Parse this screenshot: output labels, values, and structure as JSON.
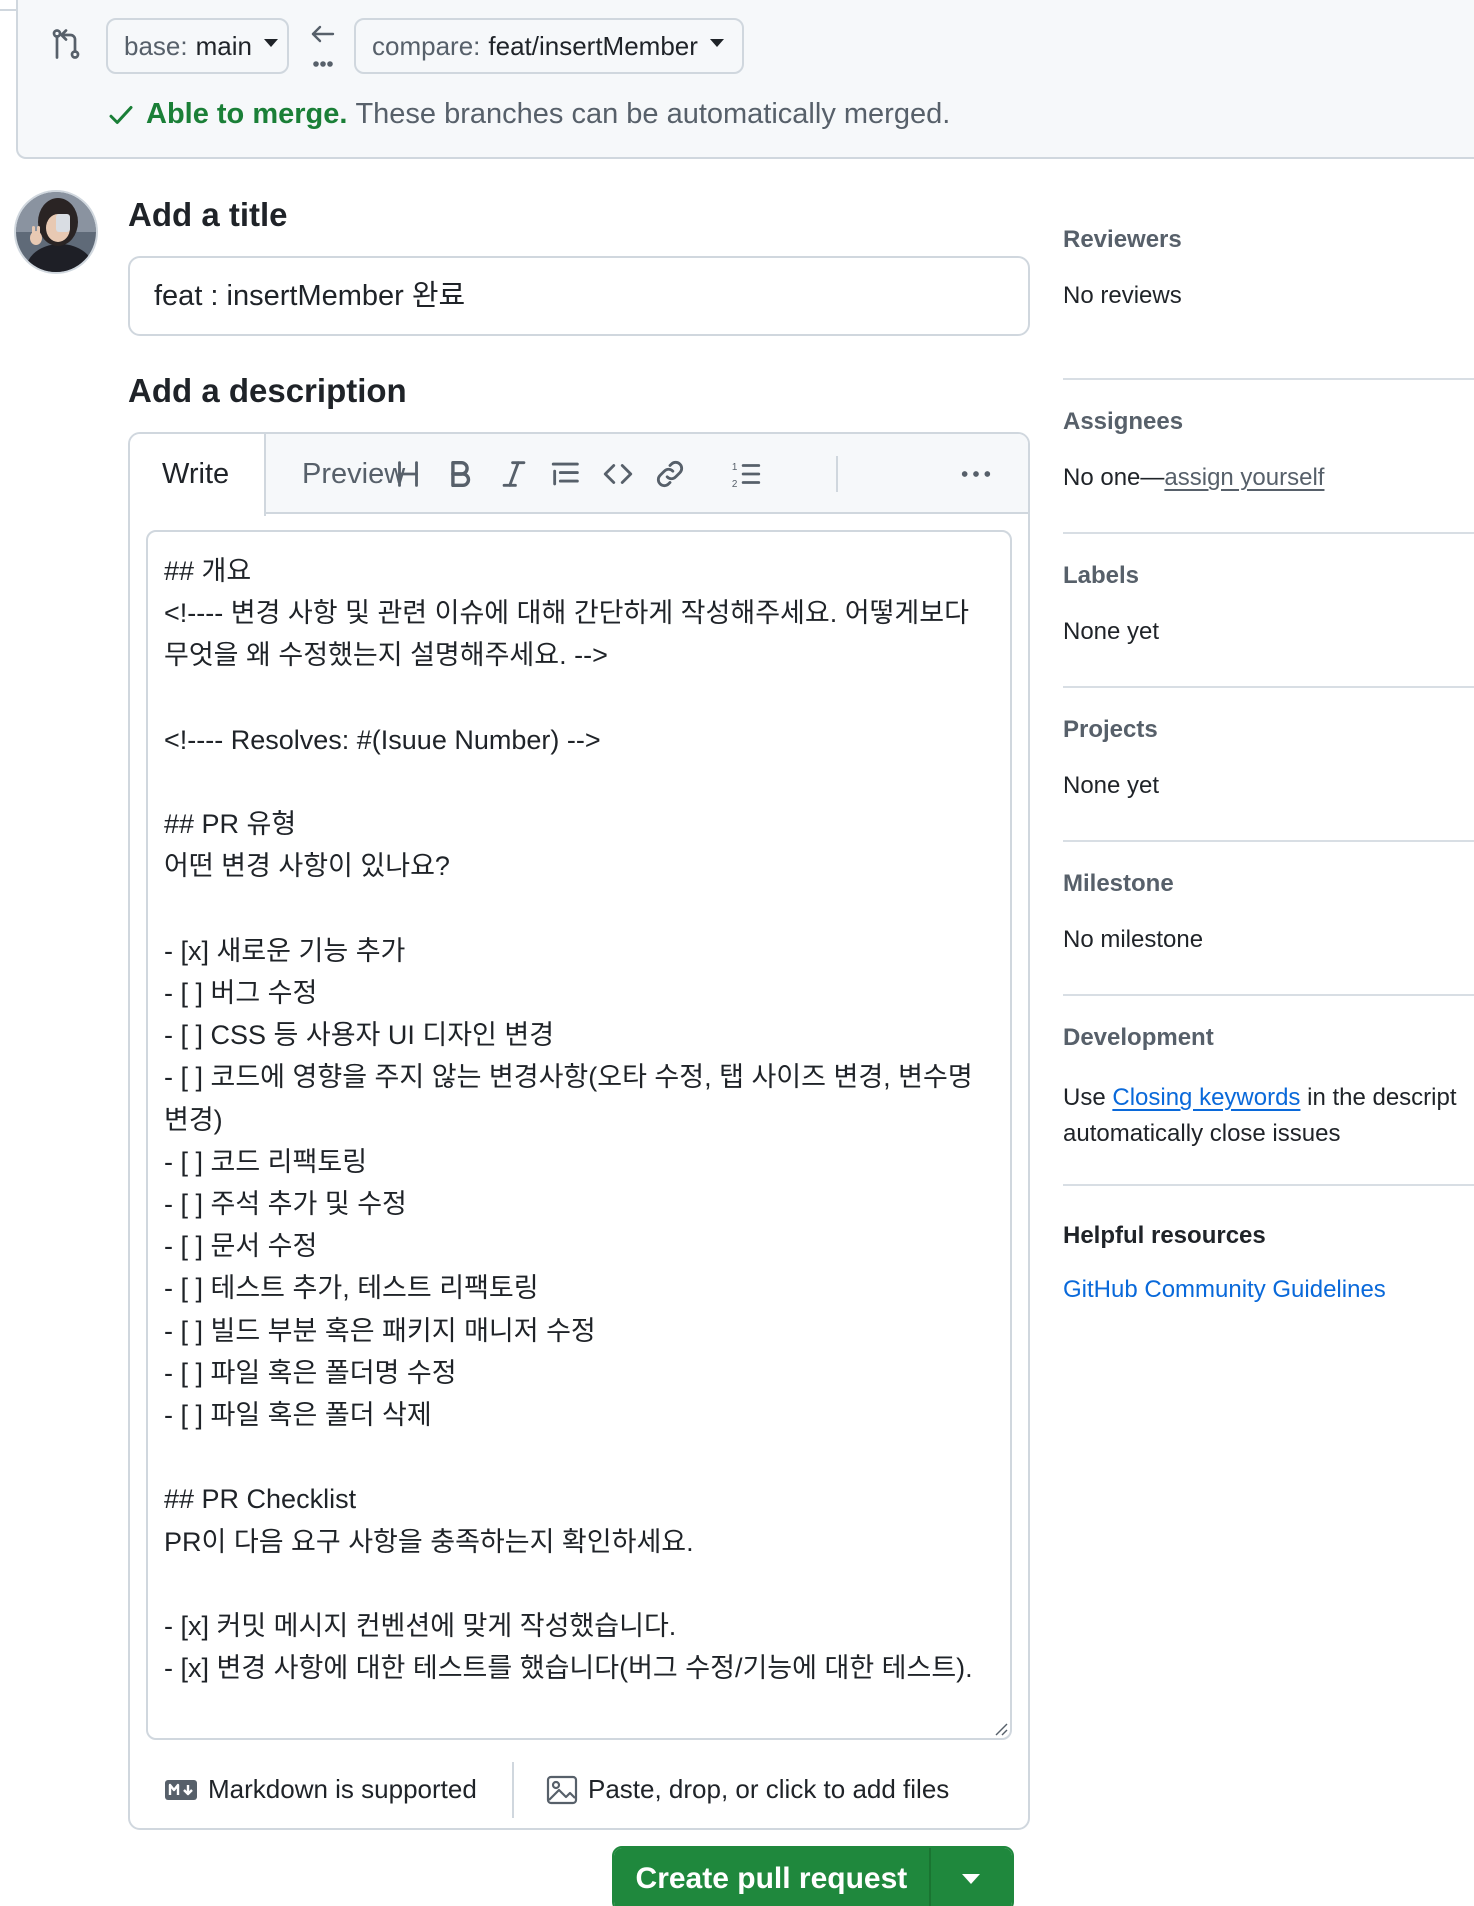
{
  "compare_bar": {
    "base_prefix": "base:",
    "base_value": "main",
    "compare_prefix": "compare:",
    "compare_value": "feat/insertMember",
    "merge_status": "Able to merge.",
    "merge_message": "These branches can be automatically merged."
  },
  "form": {
    "title_heading": "Add a title",
    "title_value": "feat : insertMember 완료",
    "description_heading": "Add a description",
    "tabs": [
      "Write",
      "Preview"
    ],
    "toolbar_icons": [
      "heading-icon",
      "bold-icon",
      "italic-icon",
      "quote-icon",
      "code-icon",
      "link-icon",
      "numbered-list-icon",
      "more-options-icon"
    ],
    "description_body": "## 개요\n<!---- 변경 사항 및 관련 이슈에 대해 간단하게 작성해주세요. 어떻게보다 무엇을 왜 수정했는지 설명해주세요. -->\n\n<!---- Resolves: #(Isuue Number) -->\n\n## PR 유형\n어떤 변경 사항이 있나요?\n\n- [x] 새로운 기능 추가\n- [ ] 버그 수정\n- [ ] CSS 등 사용자 UI 디자인 변경\n- [ ] 코드에 영향을 주지 않는 변경사항(오타 수정, 탭 사이즈 변경, 변수명 변경)\n- [ ] 코드 리팩토링\n- [ ] 주석 추가 및 수정\n- [ ] 문서 수정\n- [ ] 테스트 추가, 테스트 리팩토링\n- [ ] 빌드 부분 혹은 패키지 매니저 수정\n- [ ] 파일 혹은 폴더명 수정\n- [ ] 파일 혹은 폴더 삭제\n\n## PR Checklist\nPR이 다음 요구 사항을 충족하는지 확인하세요.\n\n- [x] 커밋 메시지 컨벤션에 맞게 작성했습니다.\n- [x] 변경 사항에 대한 테스트를 했습니다(버그 수정/기능에 대한 테스트).",
    "markdown_note": "Markdown is supported",
    "attach_note": "Paste, drop, or click to add files",
    "create_button": "Create pull request"
  },
  "sidebar": {
    "reviewers_label": "Reviewers",
    "reviewers_value": "No reviews",
    "assignees_label": "Assignees",
    "assignees_prefix": "No one—",
    "assignees_link": "assign yourself",
    "labels_label": "Labels",
    "labels_value": "None yet",
    "projects_label": "Projects",
    "projects_value": "None yet",
    "milestone_label": "Milestone",
    "milestone_value": "No milestone",
    "development_label": "Development",
    "development_prefix": "Use ",
    "development_link": "Closing keywords",
    "development_suffix": " in the descript",
    "development_line2": "automatically close issues",
    "helpful_label": "Helpful resources",
    "helpful_link": "GitHub Community Guidelines"
  },
  "colors": {
    "success": "#1a7f37",
    "primary_button": "#1f883d",
    "link": "#0969da",
    "border": "#d0d7de",
    "muted_text": "#57606a"
  }
}
